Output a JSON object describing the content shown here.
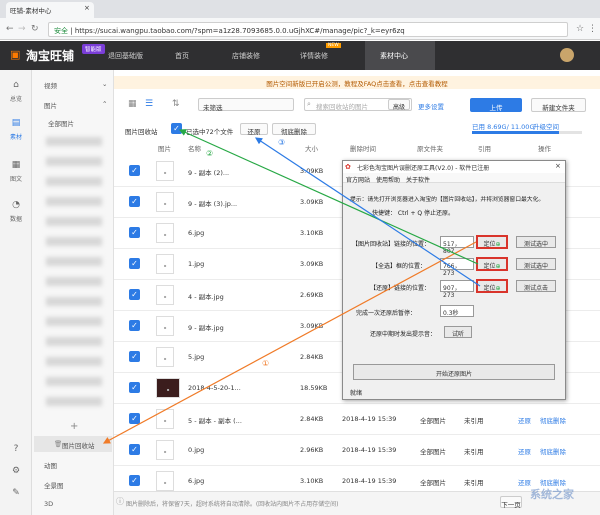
{
  "browser": {
    "tab_title": "旺铺-素材中心",
    "close": "×",
    "security": "安全",
    "url": "https://sucai.wangpu.taobao.com/?spm=a1z28.7093685.0.0.uGjhXC#/manage/pic?_k=eyr6zq"
  },
  "topnav": {
    "logo": "淘宝旺铺",
    "badge": "智能版",
    "items": [
      "退回基础版",
      "首页",
      "店铺装修",
      "详情装修",
      "素材中心"
    ],
    "new_tag": "NEW"
  },
  "rail": [
    "总览",
    "素材",
    "图文",
    "数据"
  ],
  "sidebar": {
    "video": "视频",
    "image": "图片",
    "all_images": "全部图片",
    "recycle": "图片回收站",
    "add": "+",
    "bottom": [
      "动图",
      "全景图",
      "3D"
    ]
  },
  "notice": "图片空间新版已开启公测，教程及FAQ点击查看，点击查看教程",
  "toolbar": {
    "filter": "未筛选",
    "search_placeholder": "搜索回收站的图片",
    "advanced": "高级",
    "more": "更多设置",
    "upload": "上传",
    "new_folder": "新建文件夹",
    "usage": "已用 8.69G/ 11.00G",
    "upgrade": "升级空间"
  },
  "subbar": {
    "folder": "图片回收站",
    "selected": "已选中72个文件",
    "restore": "还原",
    "delete": "彻底删除"
  },
  "table": {
    "headers": [
      "图片",
      "名称",
      "大小",
      "删除时间",
      "原文件夹",
      "引用",
      "操作"
    ],
    "rows": [
      {
        "name": "9 - 副本 (2)...",
        "size": "3.09KB",
        "time": "",
        "folder": "",
        "ref": ""
      },
      {
        "name": "9 - 副本 (3).jp...",
        "size": "3.09KB",
        "time": "",
        "folder": "",
        "ref": ""
      },
      {
        "name": "6.jpg",
        "size": "3.10KB",
        "time": "",
        "folder": "",
        "ref": ""
      },
      {
        "name": "1.jpg",
        "size": "3.09KB",
        "time": "",
        "folder": "",
        "ref": ""
      },
      {
        "name": "4 - 副本.jpg",
        "size": "2.69KB",
        "time": "",
        "folder": "",
        "ref": ""
      },
      {
        "name": "9 - 副本.jpg",
        "size": "3.09KB",
        "time": "",
        "folder": "",
        "ref": ""
      },
      {
        "name": "5.jpg",
        "size": "2.84KB",
        "time": "",
        "folder": "",
        "ref": ""
      },
      {
        "name": "2018-4-5-20-1...",
        "size": "18.59KB",
        "time": "",
        "folder": "",
        "ref": ""
      },
      {
        "name": "5 - 副本 - 副本 (...",
        "size": "2.84KB",
        "time": "2018-4-19 15:39",
        "folder": "全部图片",
        "ref": "未引用"
      },
      {
        "name": "0.jpg",
        "size": "2.96KB",
        "time": "2018-4-19 15:39",
        "folder": "全部图片",
        "ref": "未引用"
      },
      {
        "name": "6.jpg",
        "size": "3.10KB",
        "time": "2018-4-19 15:39",
        "folder": "全部图片",
        "ref": "未引用"
      }
    ],
    "op_restore": "还原",
    "op_delete": "彻底删除"
  },
  "dialog": {
    "title": "七彩色淘宝图片误删还原工具(V2.0) - 软件已注册",
    "menu": [
      "官方网站",
      "使用帮助",
      "关于软件"
    ],
    "tip1": "提示：请先打开浏览器进入淘宝的【图片回收站】，并将浏览器窗口最大化。",
    "tip2": "快捷键： Ctrl + Q 停止还原。",
    "rows": [
      {
        "label": "【图片回收站】链接的位置：",
        "value": "517，807",
        "locate": "定位",
        "test": "测试选中"
      },
      {
        "label": "【全选】框的位置：",
        "value": "766，273",
        "locate": "定位",
        "test": "测试选中"
      },
      {
        "label": "【还原】链接的位置：",
        "value": "907，273",
        "locate": "定位",
        "test": "测试点击"
      }
    ],
    "pause_label": "完成一次还原后暂停：",
    "pause_value": "0.3秒",
    "sound_label": "还原中期时发出提示音：",
    "sound_btn": "试听",
    "start": "开始还原图片",
    "status": "就绪"
  },
  "annotations": [
    "①",
    "②",
    "③"
  ],
  "footer": "图片删除后，将保留7天，超时系统将自动清除。(回收站内图片不占用存储空间)",
  "footer_page": "下一页",
  "watermark": "系统之家"
}
